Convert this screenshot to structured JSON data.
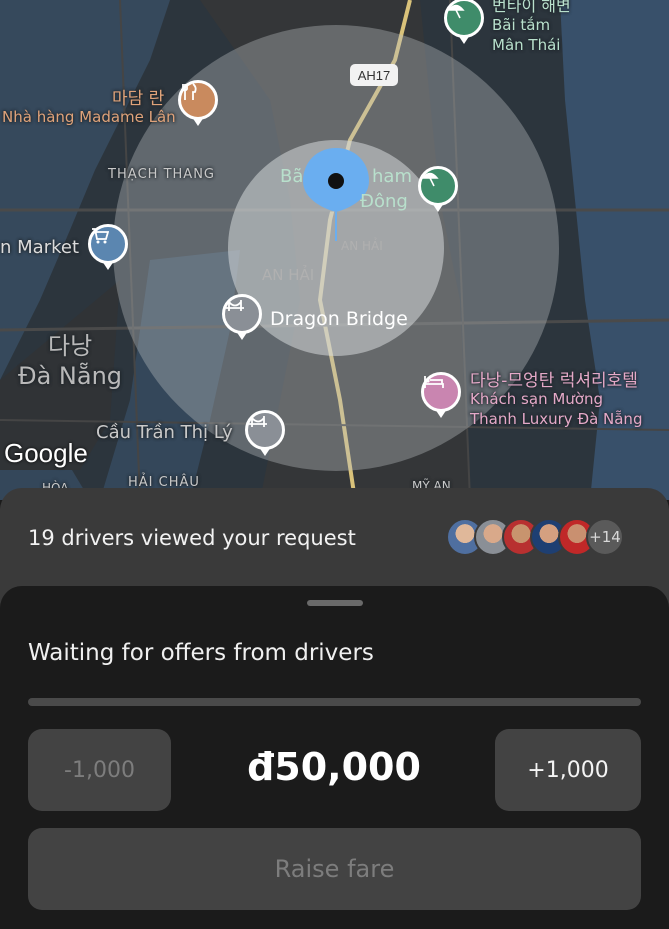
{
  "map": {
    "google_logo": "Google",
    "road_badge": "AH17",
    "labels": {
      "korean_madame_lan": "마담 란",
      "madame_lan": "Nhà hàng Madame Lân",
      "thach_thang": "THẠCH THANG",
      "market": "n Market",
      "korean_danang": "다낭",
      "da_nang": "Đà Nẵng",
      "cau_tran_thi_ly": "Cầu Trần Thị Lý",
      "hai_chau": "HẢI CHÂU",
      "hoa": "HÒA",
      "my_an": "MỸ AN",
      "an_hai_small": "AN HẢI",
      "an_hai": "AN HẢI",
      "dragon_bridge": "Dragon Bridge",
      "bai_tam_korean": "번타이 해변",
      "bai_tam": "Bãi tắm",
      "man_thai": "Mân Thái",
      "pham_partial": "Bã",
      "pham_partial2": "ham",
      "dong": "Đông",
      "hotel_korean": "다낭-므엉탄 럭셔리호텔",
      "hotel_line1": "Khách sạn Mường",
      "hotel_line2": "Thanh Luxury Đà Nẵng"
    },
    "icons": [
      "restaurant-icon",
      "shopping-cart-icon",
      "bridge-icon",
      "beach-umbrella-icon",
      "hotel-bed-icon",
      "location-pin-icon"
    ]
  },
  "drivers": {
    "viewed_text": "19 drivers viewed your request",
    "extra_count": "+14"
  },
  "sheet": {
    "waiting_text": "Waiting for offers from drivers",
    "progress_fraction": 0.0,
    "minus_label": "-1,000",
    "price": "đ50,000",
    "plus_label": "+1,000",
    "raise_label": "Raise fare"
  },
  "colors": {
    "sheet_bg": "#1b1b1b",
    "card_bg": "#3a3a3a",
    "button_bg": "#434343",
    "pin_blue": "#6aaef0"
  }
}
